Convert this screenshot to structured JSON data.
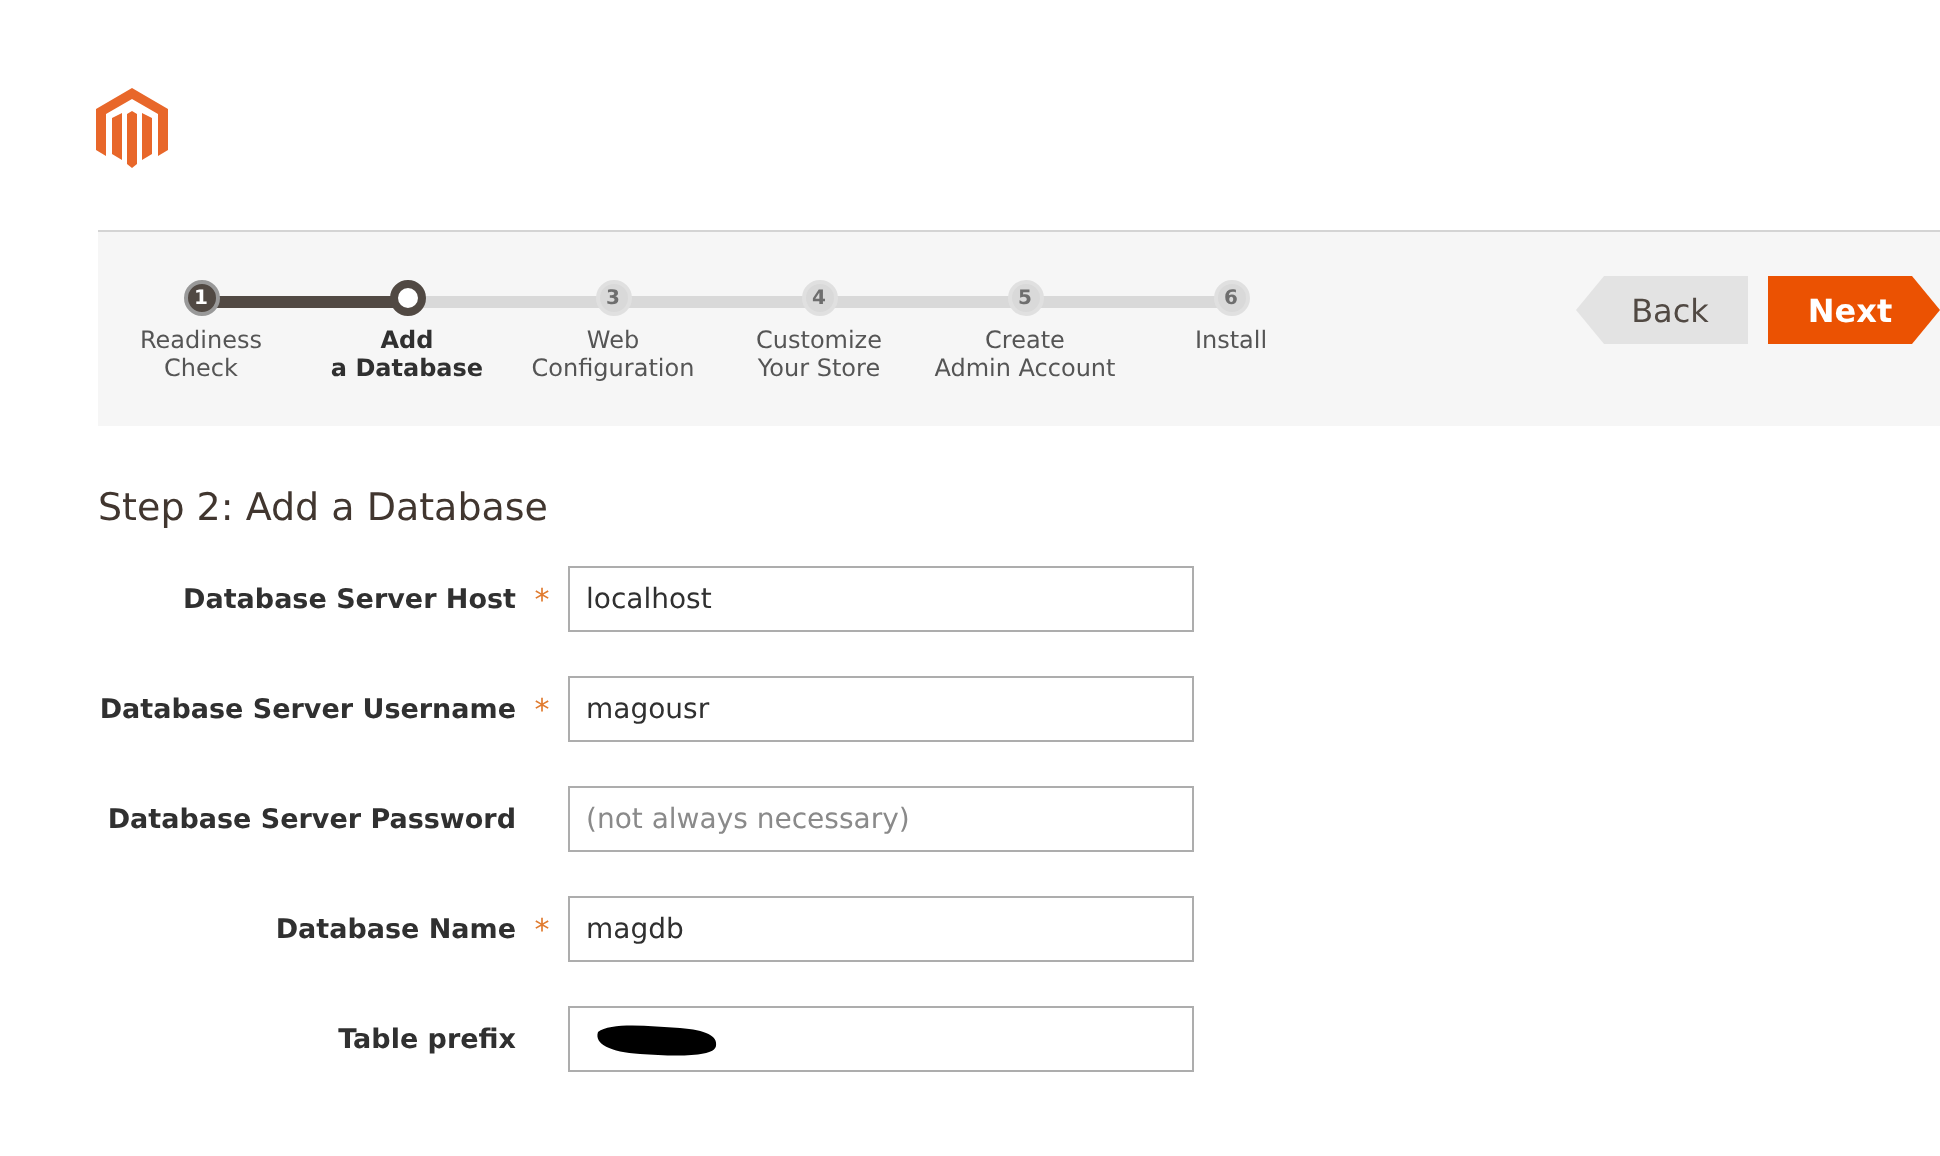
{
  "steps": [
    {
      "number": "1",
      "label": "Readiness Check",
      "done": true,
      "selected": false
    },
    {
      "label": "Add a Database",
      "done": false,
      "selected": true
    },
    {
      "number": "3",
      "label": "Web Configuration",
      "done": false,
      "selected": false
    },
    {
      "number": "4",
      "label": "Customize Your Store",
      "done": false,
      "selected": false
    },
    {
      "number": "5",
      "label": "Create Admin Account",
      "done": false,
      "selected": false
    },
    {
      "number": "6",
      "label": "Install",
      "done": false,
      "selected": false
    }
  ],
  "buttons": {
    "back": "Back",
    "next": "Next"
  },
  "heading": "Step 2: Add a Database",
  "fields": [
    {
      "label": "Database Server Host",
      "required": true,
      "kind": "text",
      "value": "localhost"
    },
    {
      "label": "Database Server Username",
      "required": true,
      "kind": "text",
      "value": "magousr"
    },
    {
      "label": "Database Server Password",
      "required": false,
      "kind": "text",
      "placeholder": "(not always necessary)"
    },
    {
      "label": "Database Name",
      "required": true,
      "kind": "text",
      "value": "magdb"
    },
    {
      "label": "Table prefix",
      "required": false,
      "kind": "redacted"
    }
  ],
  "required_mark": "*"
}
